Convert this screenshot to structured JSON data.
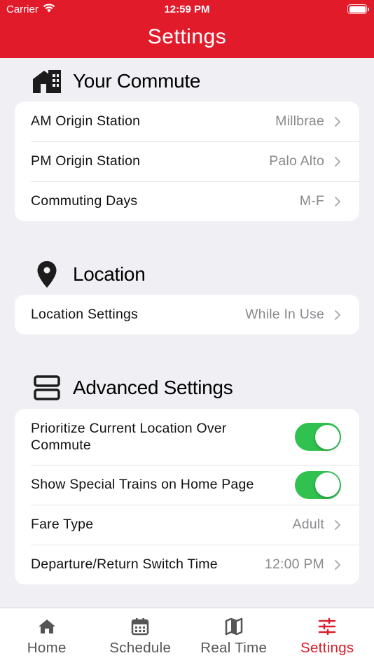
{
  "status_bar": {
    "carrier": "Carrier",
    "time": "12:59 PM"
  },
  "header": {
    "title": "Settings",
    "color": "#e21b2b"
  },
  "sections": {
    "commute": {
      "title": "Your Commute",
      "icon": "house-icon",
      "rows": [
        {
          "label": "AM Origin Station",
          "value": "Millbrae"
        },
        {
          "label": "PM Origin Station",
          "value": "Palo Alto"
        },
        {
          "label": "Commuting Days",
          "value": "M-F"
        }
      ]
    },
    "location": {
      "title": "Location",
      "icon": "location-pin-icon",
      "rows": [
        {
          "label": "Location Settings",
          "value": "While In Use"
        }
      ]
    },
    "advanced": {
      "title": "Advanced Settings",
      "icon": "stack-icon",
      "toggles": [
        {
          "label": "Prioritize Current Location Over Commute",
          "on": true
        },
        {
          "label": "Show Special Trains on Home Page",
          "on": true
        }
      ],
      "rows": [
        {
          "label": "Fare Type",
          "value": "Adult"
        },
        {
          "label": "Departure/Return Switch Time",
          "value": "12:00 PM"
        }
      ]
    }
  },
  "tabs": [
    {
      "label": "Home",
      "icon": "home-icon",
      "active": false
    },
    {
      "label": "Schedule",
      "icon": "calendar-icon",
      "active": false
    },
    {
      "label": "Real Time",
      "icon": "map-icon",
      "active": false
    },
    {
      "label": "Settings",
      "icon": "sliders-icon",
      "active": true
    }
  ],
  "colors": {
    "toggle_on": "#30c14f",
    "active_tab": "#d81e2a",
    "background": "#efeff4"
  }
}
